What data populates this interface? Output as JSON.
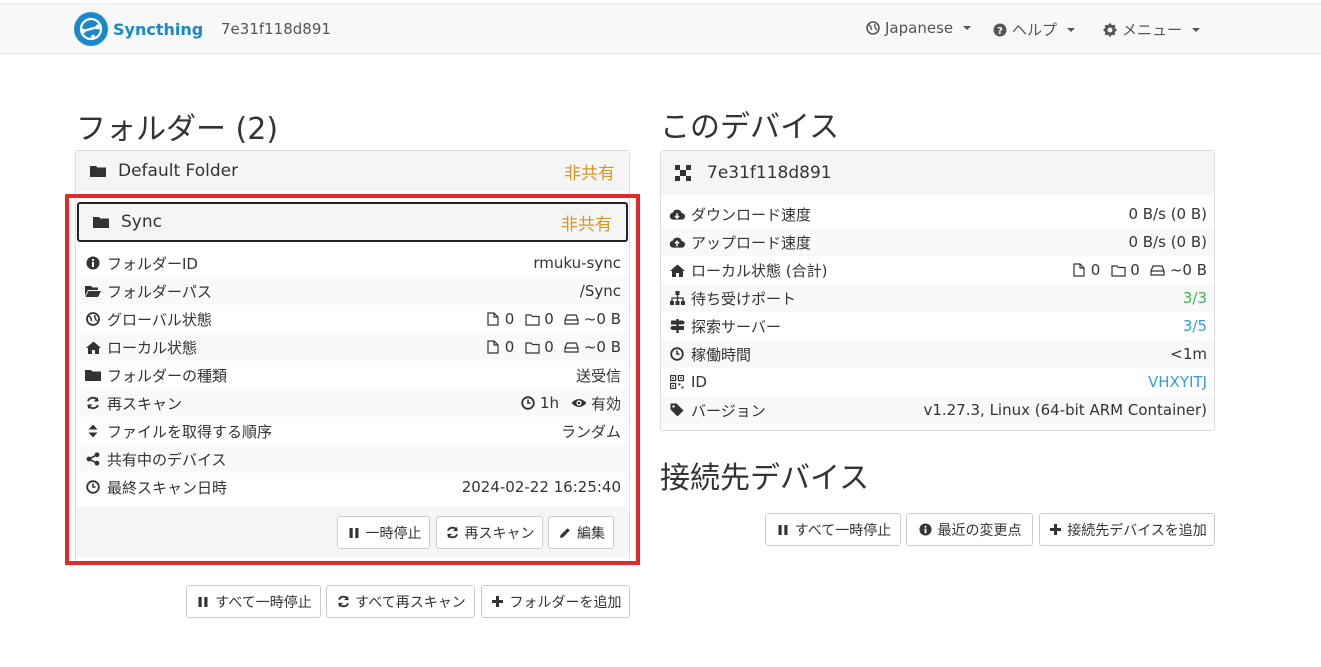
{
  "navbar": {
    "brand": "Syncthing",
    "device_id": "7e31f118d891",
    "language": "Japanese",
    "help": "ヘルプ",
    "menu": "メニュー"
  },
  "folders": {
    "title": "フォルダー (2)",
    "default_folder": {
      "name": "Default Folder",
      "status": "非共有"
    },
    "sync_folder": {
      "name": "Sync",
      "status": "非共有",
      "rows": [
        {
          "label": "フォルダーID",
          "value": "rmuku-sync",
          "icon": "info-icon"
        },
        {
          "label": "フォルダーパス",
          "value": "/Sync",
          "icon": "folder-open-icon"
        },
        {
          "label": "グローバル状態",
          "files": "0",
          "dirs": "0",
          "size": "~0 B",
          "icon": "globe-icon"
        },
        {
          "label": "ローカル状態",
          "files": "0",
          "dirs": "0",
          "size": "~0 B",
          "icon": "home-icon"
        },
        {
          "label": "フォルダーの種類",
          "value": "送受信",
          "icon": "folder-icon"
        },
        {
          "label": "再スキャン",
          "interval": "1h",
          "watch": "有効",
          "icon": "refresh-icon"
        },
        {
          "label": "ファイルを取得する順序",
          "value": "ランダム",
          "icon": "sort-icon"
        },
        {
          "label": "共有中のデバイス",
          "value": "",
          "icon": "share-icon"
        },
        {
          "label": "最終スキャン日時",
          "value": "2024-02-22 16:25:40",
          "icon": "clock-icon"
        }
      ],
      "buttons": {
        "pause": "一時停止",
        "rescan": "再スキャン",
        "edit": "編集"
      }
    },
    "actions": {
      "pause_all": "すべて一時停止",
      "rescan_all": "すべて再スキャン",
      "add_folder": "フォルダーを追加"
    }
  },
  "this_device": {
    "title": "このデバイス",
    "name": "7e31f118d891",
    "rows": [
      {
        "label": "ダウンロード速度",
        "value": "0 B/s (0 B)",
        "icon": "cloud-download-icon"
      },
      {
        "label": "アップロード速度",
        "value": "0 B/s (0 B)",
        "icon": "cloud-upload-icon"
      },
      {
        "label": "ローカル状態 (合計)",
        "files": "0",
        "dirs": "0",
        "size": "~0 B",
        "icon": "home-icon"
      },
      {
        "label": "待ち受けポート",
        "value": "3/3",
        "icon": "sitemap-icon"
      },
      {
        "label": "探索サーバー",
        "value": "3/5",
        "icon": "signpost-icon"
      },
      {
        "label": "稼働時間",
        "value": "<1m",
        "icon": "clock-icon"
      },
      {
        "label": "ID",
        "value": "VHXYITJ",
        "icon": "qrcode-icon"
      },
      {
        "label": "バージョン",
        "value": "v1.27.3, Linux (64-bit ARM Container)",
        "icon": "tag-icon"
      }
    ]
  },
  "remote_devices": {
    "title": "接続先デバイス",
    "actions": {
      "pause_all": "すべて一時停止",
      "recent_changes": "最近の変更点",
      "add_device": "接続先デバイスを追加"
    }
  },
  "colors": {
    "accent": "#1a88c9",
    "unshared": "#d9962b",
    "highlight": "#e12b2b",
    "ok": "#3cb44b",
    "link": "#3a9ad9"
  }
}
